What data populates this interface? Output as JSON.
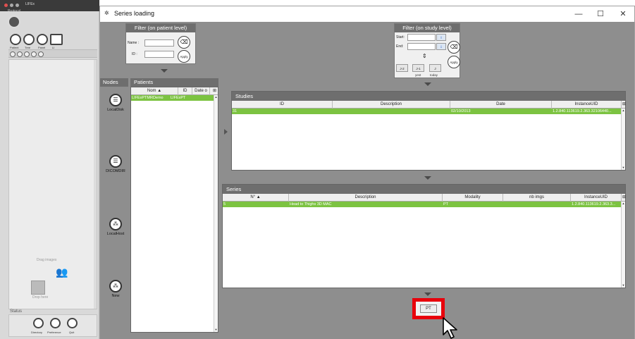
{
  "bg_app": {
    "title": "LIFEx",
    "protocol": "Protocol",
    "toolbar_labels": [
      "Patient",
      "Tree",
      "Panel",
      "LI"
    ],
    "drag_label": "Drag images",
    "drop_label": "Drop here",
    "status": "Status",
    "bottom_labels": [
      "Directory",
      "Preference",
      "Quit"
    ]
  },
  "window": {
    "title": "Series loading",
    "controls": {
      "minimize": "—",
      "maximize": "☐",
      "close": "✕"
    }
  },
  "filter_patient": {
    "header": "Filter (on patient level)",
    "name_label": "Name :",
    "id_label": "ID :",
    "name_value": "",
    "id_value": "",
    "apply": "Apply"
  },
  "filter_study": {
    "header": "Filter (on study level)",
    "start_label": "Start:",
    "end_label": "End:",
    "start_value": "",
    "end_value": "",
    "apply": "Apply",
    "quick": [
      "J-2",
      "J-1",
      "J"
    ],
    "quick_labels": [
      "yest",
      "today"
    ]
  },
  "nodes": {
    "header": "Nodes",
    "items": [
      {
        "label": "LocalDisk"
      },
      {
        "label": "DICOMDIR"
      },
      {
        "label": "LocalHost"
      },
      {
        "label": "New"
      }
    ]
  },
  "patients": {
    "header": "Patients",
    "columns": [
      "Nom ▲",
      "ID",
      "Date o"
    ],
    "rows": [
      [
        "LIFExPTMRDemo",
        "LIFExPT",
        ""
      ]
    ]
  },
  "studies": {
    "title": "Studies",
    "columns": [
      "ID",
      "Description",
      "Date",
      "InstanceUID"
    ],
    "rows": [
      [
        "31",
        "",
        "02/10/2013",
        "1.2.840.113619.2.363.32106440..."
      ]
    ]
  },
  "series": {
    "title": "Series",
    "columns": [
      "N° ▲",
      "Description",
      "Modality",
      "nb imgs",
      "InstanceUID"
    ],
    "rows": [
      [
        "5",
        "Head to Thighs 3D MAC",
        "PT",
        "",
        "1.2.840.113619.2.363.3..."
      ]
    ]
  },
  "modality_button": {
    "label": "PT"
  },
  "colors": {
    "selected_row": "#7cc341",
    "highlight": "#e8000b",
    "panel_header": "#6e6e6e",
    "window_bg": "#8e8e8e"
  }
}
